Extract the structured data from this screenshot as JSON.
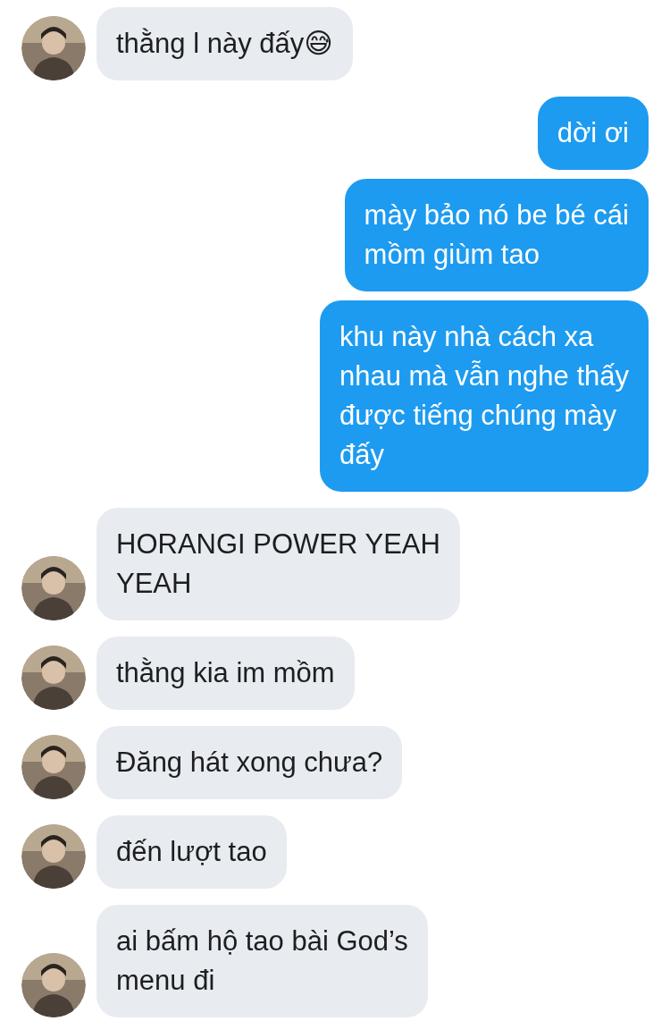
{
  "messages": [
    {
      "kind": "incoming",
      "text": "thằng l này đấy😅"
    },
    {
      "kind": "outgoing",
      "text": "dời ơi"
    },
    {
      "kind": "outgoing",
      "text": "mày bảo nó be bé cái\nmồm giùm tao"
    },
    {
      "kind": "outgoing",
      "text": "khu này nhà cách xa\nnhau mà vẫn nghe thấy\nđược tiếng chúng mày\nđấy"
    },
    {
      "kind": "incoming",
      "text": "HORANGI POWER YEAH\nYEAH"
    },
    {
      "kind": "incoming",
      "text": "thằng kia im mồm"
    },
    {
      "kind": "incoming",
      "text": "Đăng hát xong chưa?"
    },
    {
      "kind": "incoming",
      "text": "đến lượt tao"
    },
    {
      "kind": "incoming",
      "text": "ai bấm hộ tao bài God’s\nmenu đi"
    }
  ]
}
